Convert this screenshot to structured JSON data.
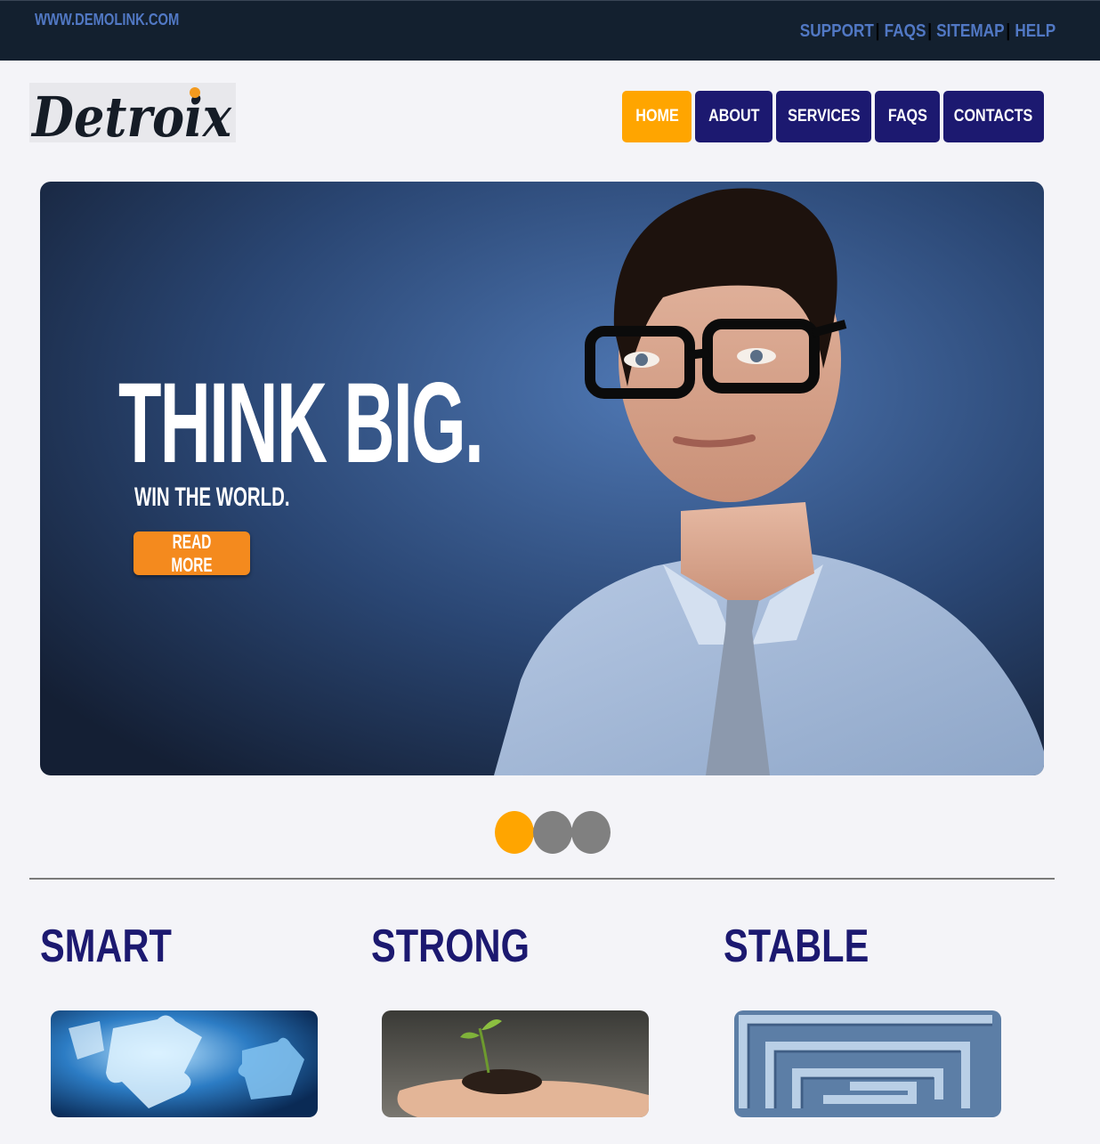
{
  "topbar": {
    "site_link": "WWW.DEMOLINK.COM",
    "links": [
      "SUPPORT",
      "FAQS",
      "SITEMAP",
      "HELP"
    ]
  },
  "header": {
    "logo_text": "Detroix",
    "nav": [
      "HOME",
      "ABOUT",
      "SERVICES",
      "FAQS",
      "CONTACTS"
    ],
    "active_nav": "HOME"
  },
  "hero": {
    "title": "THINK BIG.",
    "subtitle": "WIN THE WORLD.",
    "button_label": "READ MORE",
    "image": "man-with-glasses-photo"
  },
  "slider": {
    "total_slides": 3,
    "current_slide": 1
  },
  "features": [
    {
      "title": "SMART",
      "image": "puzzle-pieces-photo"
    },
    {
      "title": "STRONG",
      "image": "seedling-in-hand-photo"
    },
    {
      "title": "STABLE",
      "image": "maze-photo"
    }
  ],
  "colors": {
    "topbar_bg": "#13202f",
    "link": "#5178c4",
    "nav_bg": "#1c1970",
    "accent": "#ffa500",
    "hero_button": "#f48a1e",
    "heading": "#1c1970",
    "page_bg": "#f4f4f8"
  }
}
